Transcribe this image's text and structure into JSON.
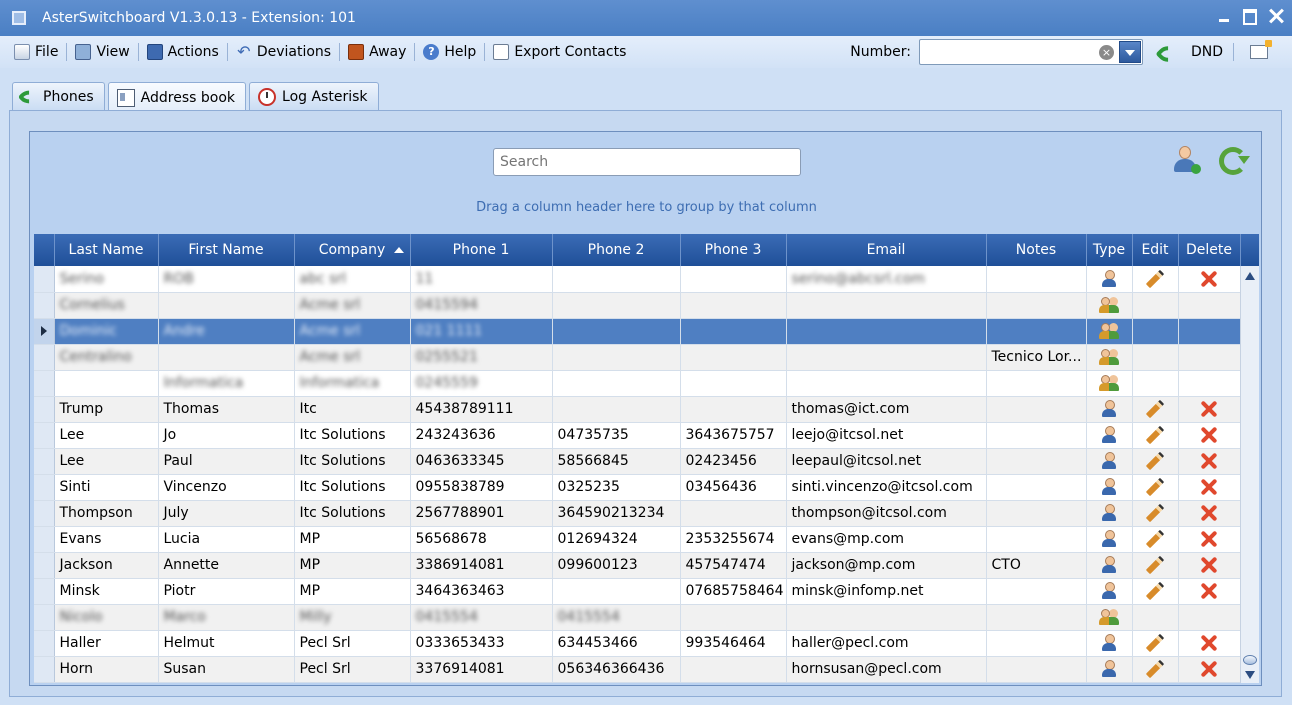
{
  "window": {
    "title": "AsterSwitchboard V1.3.0.13 - Extension: 101"
  },
  "menu": {
    "file": "File",
    "view": "View",
    "actions": "Actions",
    "deviations": "Deviations",
    "away": "Away",
    "help": "Help",
    "export": "Export Contacts"
  },
  "toolbar": {
    "number_label": "Number:",
    "number_value": "",
    "dnd_label": "DND"
  },
  "tabs": [
    {
      "label": "Phones"
    },
    {
      "label": "Address book"
    },
    {
      "label": "Log Asterisk"
    }
  ],
  "address_book": {
    "search_placeholder": "Search",
    "group_hint": "Drag a column header here to group by that column",
    "columns": [
      "Last Name",
      "First Name",
      "Company",
      "Phone 1",
      "Phone 2",
      "Phone 3",
      "Email",
      "Notes",
      "Type",
      "Edit",
      "Delete"
    ],
    "sorted_column": "Company",
    "rows": [
      {
        "last": "Serino",
        "first": "ROB",
        "company": "abc srl",
        "p1": "11",
        "p2": "",
        "p3": "",
        "email": "serino@abcsrl.com",
        "notes": "",
        "type": "person",
        "editable": true,
        "blurred": true,
        "selected": false
      },
      {
        "last": "Cornelius",
        "first": "",
        "company": "Acme srl",
        "p1": "0415594",
        "p2": "",
        "p3": "",
        "email": "",
        "notes": "",
        "type": "group",
        "editable": false,
        "blurred": true,
        "selected": false
      },
      {
        "last": "Dominic",
        "first": "Andre",
        "company": "Acme srl",
        "p1": "021 1111",
        "p2": "",
        "p3": "",
        "email": "",
        "notes": "",
        "type": "group",
        "editable": false,
        "blurred": true,
        "selected": true
      },
      {
        "last": "Centralino",
        "first": "",
        "company": "Acme srl",
        "p1": "0255521",
        "p2": "",
        "p3": "",
        "email": "",
        "notes": "Tecnico Lor...",
        "type": "group",
        "editable": false,
        "blurred": true,
        "selected": false
      },
      {
        "last": "",
        "first": "Informatica",
        "company": "Informatica",
        "p1": "0245559",
        "p2": "",
        "p3": "",
        "email": "",
        "notes": "",
        "type": "group",
        "editable": false,
        "blurred": true,
        "selected": false
      },
      {
        "last": "Trump",
        "first": "Thomas",
        "company": "Itc",
        "p1": "45438789111",
        "p2": "",
        "p3": "",
        "email": "thomas@ict.com",
        "notes": "",
        "type": "person",
        "editable": true,
        "blurred": false,
        "selected": false
      },
      {
        "last": "Lee",
        "first": "Jo",
        "company": "Itc Solutions",
        "p1": "243243636",
        "p2": "04735735",
        "p3": "3643675757",
        "email": "leejo@itcsol.net",
        "notes": "",
        "type": "person",
        "editable": true,
        "blurred": false,
        "selected": false
      },
      {
        "last": "Lee",
        "first": "Paul",
        "company": "Itc Solutions",
        "p1": "0463633345",
        "p2": "58566845",
        "p3": "02423456",
        "email": "leepaul@itcsol.net",
        "notes": "",
        "type": "person",
        "editable": true,
        "blurred": false,
        "selected": false
      },
      {
        "last": "Sinti",
        "first": "Vincenzo",
        "company": "Itc Solutions",
        "p1": "0955838789",
        "p2": "0325235",
        "p3": "03456436",
        "email": "sinti.vincenzo@itcsol.com",
        "notes": "",
        "type": "person",
        "editable": true,
        "blurred": false,
        "selected": false
      },
      {
        "last": "Thompson",
        "first": "July",
        "company": "Itc Solutions",
        "p1": "2567788901",
        "p2": "364590213234",
        "p3": "",
        "email": "thompson@itcsol.com",
        "notes": "",
        "type": "person",
        "editable": true,
        "blurred": false,
        "selected": false
      },
      {
        "last": "Evans",
        "first": "Lucia",
        "company": "MP",
        "p1": "56568678",
        "p2": "012694324",
        "p3": "2353255674",
        "email": "evans@mp.com",
        "notes": "",
        "type": "person",
        "editable": true,
        "blurred": false,
        "selected": false
      },
      {
        "last": "Jackson",
        "first": "Annette",
        "company": "MP",
        "p1": "3386914081",
        "p2": "099600123",
        "p3": "457547474",
        "email": "jackson@mp.com",
        "notes": "CTO",
        "type": "person",
        "editable": true,
        "blurred": false,
        "selected": false
      },
      {
        "last": "Minsk",
        "first": "Piotr",
        "company": "MP",
        "p1": "3464363463",
        "p2": "",
        "p3": "07685758464",
        "email": "minsk@infomp.net",
        "notes": "",
        "type": "person",
        "editable": true,
        "blurred": false,
        "selected": false
      },
      {
        "last": "Nicolo",
        "first": "Marco",
        "company": "Milly",
        "p1": "0415554",
        "p2": "0415554",
        "p3": "",
        "email": "",
        "notes": "",
        "type": "group",
        "editable": false,
        "blurred": true,
        "selected": false
      },
      {
        "last": "Haller",
        "first": "Helmut",
        "company": "Pecl Srl",
        "p1": "0333653433",
        "p2": "634453466",
        "p3": "993546464",
        "email": "haller@pecl.com",
        "notes": "",
        "type": "person",
        "editable": true,
        "blurred": false,
        "selected": false
      },
      {
        "last": "Horn",
        "first": "Susan",
        "company": "Pecl Srl",
        "p1": "3376914081",
        "p2": "056346366436",
        "p3": "",
        "email": "hornsusan@pecl.com",
        "notes": "",
        "type": "person",
        "editable": true,
        "blurred": false,
        "selected": false
      }
    ]
  }
}
